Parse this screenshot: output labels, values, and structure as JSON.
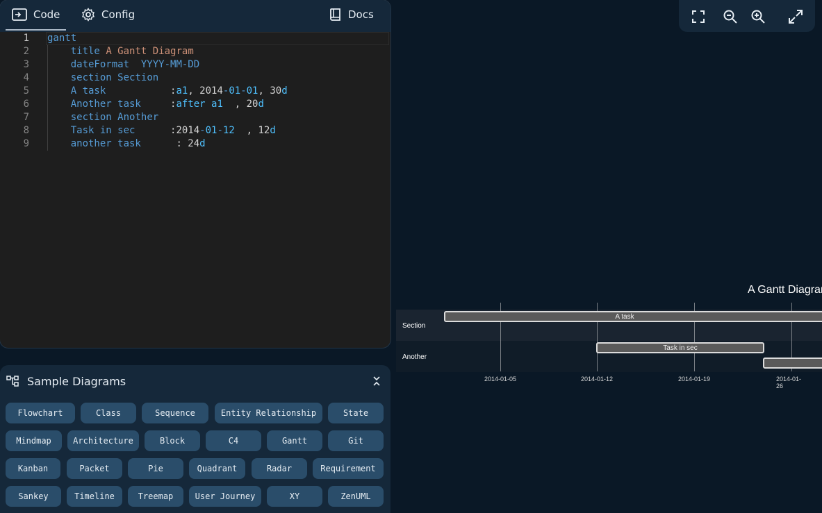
{
  "header": {
    "code_tab": "Code",
    "config_tab": "Config",
    "docs_link": "Docs"
  },
  "editor": {
    "lines": [
      {
        "n": "1",
        "parts": [
          [
            "kw",
            "gantt"
          ]
        ]
      },
      {
        "n": "2",
        "parts": [
          [
            "pl",
            "    "
          ],
          [
            "kw",
            "title"
          ],
          [
            "pl",
            " "
          ],
          [
            "str",
            "A Gantt Diagram"
          ]
        ]
      },
      {
        "n": "3",
        "parts": [
          [
            "pl",
            "    "
          ],
          [
            "kw",
            "dateFormat"
          ],
          [
            "pl",
            "  "
          ],
          [
            "kw",
            "YYYY-MM-DD"
          ]
        ]
      },
      {
        "n": "4",
        "parts": [
          [
            "pl",
            "    "
          ],
          [
            "kw",
            "section"
          ],
          [
            "pl",
            " "
          ],
          [
            "kw",
            "Section"
          ]
        ]
      },
      {
        "n": "5",
        "parts": [
          [
            "pl",
            "    "
          ],
          [
            "kw",
            "A task"
          ],
          [
            "pl",
            "           :"
          ],
          [
            "lb",
            "a1"
          ],
          [
            "pl",
            ", 2014"
          ],
          [
            "kw",
            "-"
          ],
          [
            "lb",
            "01"
          ],
          [
            "kw",
            "-"
          ],
          [
            "lb",
            "01"
          ],
          [
            "pl",
            ", 30"
          ],
          [
            "lb",
            "d"
          ]
        ]
      },
      {
        "n": "6",
        "parts": [
          [
            "pl",
            "    "
          ],
          [
            "kw",
            "Another task"
          ],
          [
            "pl",
            "     :"
          ],
          [
            "lb",
            "after a1"
          ],
          [
            "pl",
            "  , 20"
          ],
          [
            "lb",
            "d"
          ]
        ]
      },
      {
        "n": "7",
        "parts": [
          [
            "pl",
            "    "
          ],
          [
            "kw",
            "section"
          ],
          [
            "pl",
            " "
          ],
          [
            "kw",
            "Another"
          ]
        ]
      },
      {
        "n": "8",
        "parts": [
          [
            "pl",
            "    "
          ],
          [
            "kw",
            "Task in sec"
          ],
          [
            "pl",
            "      :2014"
          ],
          [
            "kw",
            "-"
          ],
          [
            "lb",
            "01"
          ],
          [
            "kw",
            "-"
          ],
          [
            "lb",
            "12"
          ],
          [
            "pl",
            "  , 12"
          ],
          [
            "lb",
            "d"
          ]
        ]
      },
      {
        "n": "9",
        "parts": [
          [
            "pl",
            "    "
          ],
          [
            "kw",
            "another task"
          ],
          [
            "pl",
            "      : 24"
          ],
          [
            "lb",
            "d"
          ]
        ]
      }
    ]
  },
  "samples": {
    "title": "Sample Diagrams",
    "items": [
      "Flowchart",
      "Class",
      "Sequence",
      "Entity Relationship",
      "State",
      "Mindmap",
      "Architecture",
      "Block",
      "C4",
      "Gantt",
      "Git",
      "Kanban",
      "Packet",
      "Pie",
      "Quadrant",
      "Radar",
      "Requirement",
      "Sankey",
      "Timeline",
      "Treemap",
      "User Journey",
      "XY",
      "ZenUML"
    ]
  },
  "diagram": {
    "title": "A Gantt Diagram",
    "sections": [
      "Section",
      "Another"
    ],
    "axis_ticks": [
      "2014-01-05",
      "2014-01-12",
      "2014-01-19",
      "2014-01-26"
    ],
    "tasks": [
      {
        "label": "A task"
      },
      {
        "label": "Task in sec"
      },
      {
        "label": ""
      }
    ]
  },
  "colors": {
    "background": "#0a1826",
    "panel": "#15283a",
    "editor": "#1e1e1e",
    "chip": "#2a4d6a",
    "keyword": "#569cd6",
    "string": "#ce9178",
    "gantt_bar": "#5a5a5a"
  }
}
